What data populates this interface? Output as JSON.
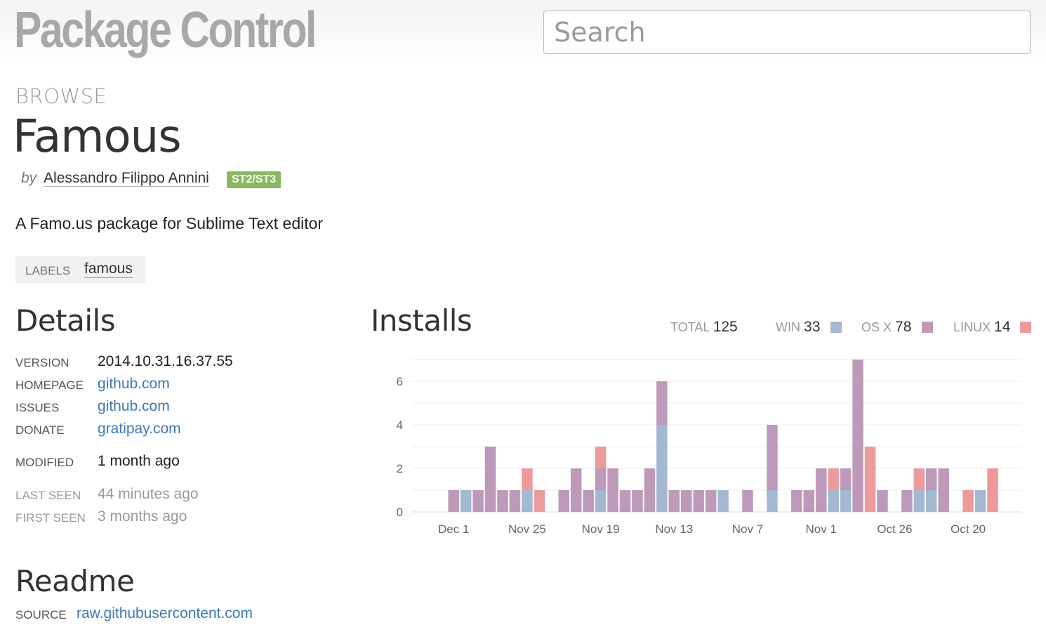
{
  "header": {
    "logo": "Package Control",
    "search_placeholder": "Search"
  },
  "package": {
    "section": "BROWSE",
    "name": "Famous",
    "by": "by",
    "author": "Alessandro Filippo Annini",
    "compat_badge": "ST2/ST3",
    "description": "A Famo.us package for Sublime Text editor",
    "labels_caption": "LABELS",
    "labels": [
      "famous"
    ]
  },
  "details": {
    "heading": "Details",
    "rows": [
      {
        "key": "VERSION",
        "value": "2014.10.31.16.37.55"
      },
      {
        "key": "HOMEPAGE",
        "value": "github.com"
      },
      {
        "key": "ISSUES",
        "value": "github.com"
      },
      {
        "key": "DONATE",
        "value": "gratipay.com"
      },
      {
        "key": "MODIFIED",
        "value": "1 month ago"
      },
      {
        "key": "LAST SEEN",
        "value": "44 minutes ago"
      },
      {
        "key": "FIRST SEEN",
        "value": "3 months ago"
      }
    ]
  },
  "installs": {
    "heading": "Installs",
    "total_label": "TOTAL",
    "total": "125",
    "win_label": "WIN",
    "win": "33",
    "osx_label": "OS X",
    "osx": "78",
    "linux_label": "LINUX",
    "linux": "14"
  },
  "readme": {
    "heading": "Readme",
    "source_label": "SOURCE",
    "source": "raw.githubusercontent.com"
  },
  "colors": {
    "win": "#a5b8d2",
    "osx": "#bd9ab9",
    "linux": "#ed9a9c",
    "link": "#3d7ab8",
    "badge": "#8ab861"
  },
  "chart_data": {
    "type": "bar",
    "stacked": true,
    "ylim": [
      0,
      7
    ],
    "yticks": [
      0,
      2,
      4,
      6
    ],
    "xtick_labels": [
      "Dec 1",
      "Nov 25",
      "Nov 19",
      "Nov 13",
      "Nov 7",
      "Nov 1",
      "Oct 26",
      "Oct 20"
    ],
    "xtick_indices": [
      1,
      7,
      13,
      19,
      25,
      31,
      37,
      43
    ],
    "series": [
      {
        "name": "WIN",
        "values": [
          0,
          0,
          1,
          0,
          0,
          0,
          0,
          1,
          0,
          0,
          0,
          0,
          0,
          1,
          0,
          0,
          0,
          0,
          4,
          0,
          0,
          0,
          0,
          1,
          0,
          0,
          0,
          1,
          0,
          0,
          0,
          0,
          1,
          1,
          0,
          0,
          0,
          0,
          0,
          1,
          1,
          0,
          0,
          0,
          1,
          0,
          0
        ]
      },
      {
        "name": "OS X",
        "values": [
          0,
          1,
          0,
          1,
          3,
          1,
          1,
          0,
          0,
          0,
          1,
          2,
          1,
          1,
          2,
          1,
          1,
          2,
          2,
          1,
          1,
          1,
          1,
          0,
          0,
          1,
          0,
          3,
          0,
          1,
          1,
          2,
          0,
          1,
          7,
          0,
          1,
          0,
          1,
          0,
          1,
          2,
          0,
          0,
          0,
          0,
          0
        ]
      },
      {
        "name": "LINUX",
        "values": [
          0,
          0,
          0,
          0,
          0,
          0,
          0,
          1,
          1,
          0,
          0,
          0,
          0,
          1,
          0,
          0,
          0,
          0,
          0,
          0,
          0,
          0,
          0,
          0,
          0,
          0,
          0,
          0,
          0,
          0,
          0,
          0,
          1,
          0,
          0,
          3,
          0,
          0,
          0,
          1,
          0,
          0,
          0,
          1,
          0,
          2,
          0
        ]
      }
    ]
  }
}
